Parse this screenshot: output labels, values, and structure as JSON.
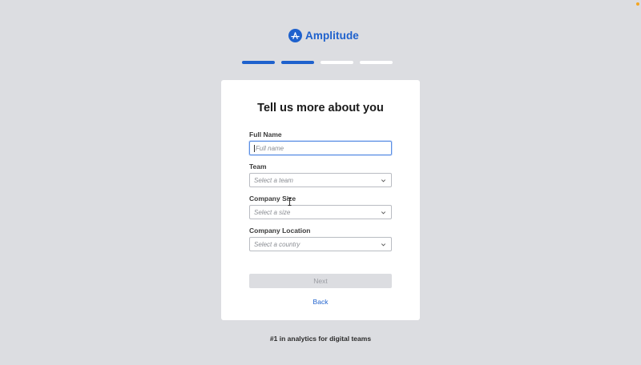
{
  "brand": {
    "name": "Amplitude",
    "color": "#1e61cd",
    "logo_icon": "amplitude-a-icon"
  },
  "progress": {
    "total_steps": 4,
    "current_step": 2
  },
  "form": {
    "title": "Tell us more about you",
    "full_name": {
      "label": "Full Name",
      "placeholder": "Full name",
      "value": ""
    },
    "team": {
      "label": "Team",
      "placeholder": "Select a team",
      "icon": "chevron-down-icon"
    },
    "company_size": {
      "label": "Company Size",
      "placeholder": "Select a size",
      "icon": "chevron-down-icon"
    },
    "company_location": {
      "label": "Company Location",
      "placeholder": "Select a country",
      "icon": "chevron-down-icon"
    },
    "next_label": "Next",
    "back_label": "Back"
  },
  "footer": {
    "tagline": "#1 in analytics for digital teams"
  }
}
